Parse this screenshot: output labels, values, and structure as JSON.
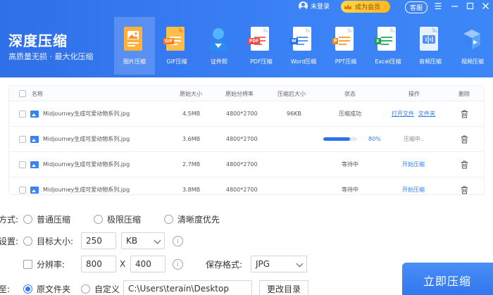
{
  "app": {
    "title": "深度压缩",
    "subtitle": "高质量无损 · 最大化压缩"
  },
  "topbar": {
    "login_label": "未登录",
    "vip_label": "成为会员",
    "service_label": "客服"
  },
  "tools": [
    {
      "label": "图片压缩",
      "icon": "image-compress-icon",
      "active": true
    },
    {
      "label": "GIF压缩",
      "icon": "gif-icon"
    },
    {
      "label": "证件照",
      "icon": "id-photo-icon"
    },
    {
      "label": "PDF压缩",
      "icon": "pdf-icon"
    },
    {
      "label": "Word压缩",
      "icon": "word-icon"
    },
    {
      "label": "PPT压缩",
      "icon": "ppt-icon"
    },
    {
      "label": "Excel压缩",
      "icon": "excel-icon"
    },
    {
      "label": "音频压缩",
      "icon": "audio-icon"
    },
    {
      "label": "视频压缩",
      "icon": "video-icon"
    }
  ],
  "table": {
    "headers": {
      "name": "名称",
      "orig_size": "原始大小",
      "orig_res": "原始分辨率",
      "new_size": "压缩后大小",
      "status": "状态",
      "action": "操作",
      "delete": "删除"
    },
    "rows": [
      {
        "name": "Midjourney生成可爱动物系列.jpg",
        "orig_size": "4.5MB",
        "orig_res": "4800*2700",
        "new_size": "96KB",
        "status": "压缩成功",
        "action_open": "打开文件",
        "action_folder": "文件夹"
      },
      {
        "name": "Midjourney生成可爱动物系列.jpg",
        "orig_size": "3.6MB",
        "orig_res": "4800*2700",
        "new_size": "",
        "progress": 0.8,
        "progress_label": "80%",
        "action": "压缩中.."
      },
      {
        "name": "Midjourney生成可爱动物系列.jpg",
        "orig_size": "2.7MB",
        "orig_res": "4800*2700",
        "new_size": "",
        "status": "等待中",
        "action": "开始压缩"
      },
      {
        "name": "Midjourney生成可爱动物系列.jpg",
        "orig_size": "3.8MB",
        "orig_res": "4800*2700",
        "new_size": "",
        "status": "等待中",
        "action": "开始压缩"
      }
    ]
  },
  "settings": {
    "mode_label": "方式:",
    "mode_options": [
      "普通压缩",
      "极限压缩",
      "清晰度优先"
    ],
    "size_label": "设置:",
    "target_size_label": "目标大小:",
    "target_size_value": "250",
    "target_unit": "KB",
    "resolution_label": "分辨率:",
    "res_width": "800",
    "res_x": "X",
    "res_height": "400",
    "format_label": "保存格式:",
    "format_value": "JPG",
    "output_label": "至:",
    "output_options": [
      "原文件夹",
      "自定义"
    ],
    "output_path": "C:\\Users\\terain\\Desktop",
    "change_dir_label": "更改目录",
    "compress_button": "立即压缩"
  },
  "colors": {
    "header_blue": "#2f6fe8",
    "accent": "#2f7cf6",
    "vip_gold": "#ffc23a"
  }
}
